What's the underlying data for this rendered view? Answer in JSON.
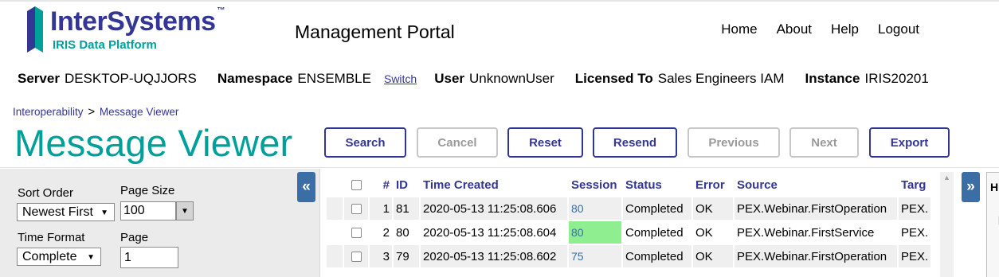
{
  "brand": {
    "name": "InterSystems",
    "trademark": "™",
    "subtitle": "IRIS Data Platform",
    "primary_color": "#333695",
    "accent_color": "#00a09a"
  },
  "header": {
    "portal_title": "Management Portal",
    "nav": [
      "Home",
      "About",
      "Help",
      "Logout"
    ]
  },
  "info": {
    "server_label": "Server",
    "server_value": "DESKTOP-UQJJORS",
    "namespace_label": "Namespace",
    "namespace_value": "ENSEMBLE",
    "switch_label": "Switch",
    "user_label": "User",
    "user_value": "UnknownUser",
    "licensed_label": "Licensed To",
    "licensed_value": "Sales Engineers IAM",
    "instance_label": "Instance",
    "instance_value": "IRIS20201"
  },
  "breadcrumb": {
    "parent": "Interoperability",
    "separator": ">",
    "current": "Message Viewer"
  },
  "page_title": "Message Viewer",
  "toolbar": {
    "buttons": [
      {
        "label": "Search",
        "enabled": true
      },
      {
        "label": "Cancel",
        "enabled": false
      },
      {
        "label": "Reset",
        "enabled": true
      },
      {
        "label": "Resend",
        "enabled": true
      },
      {
        "label": "Previous",
        "enabled": false
      },
      {
        "label": "Next",
        "enabled": false
      },
      {
        "label": "Export",
        "enabled": true
      }
    ]
  },
  "left_panel": {
    "collapse_icon": "«",
    "sort_order_label": "Sort Order",
    "sort_order_value": "Newest First",
    "page_size_label": "Page Size",
    "page_size_value": "100",
    "time_format_label": "Time Format",
    "time_format_value": "Complete",
    "page_label": "Page",
    "page_value": "1"
  },
  "table": {
    "columns": [
      "#",
      "ID",
      "Time Created",
      "Session",
      "Status",
      "Error",
      "Source",
      "Targ"
    ],
    "rows": [
      {
        "num": "1",
        "id": "81",
        "time": "2020-05-13 11:25:08.606",
        "session": "80",
        "status": "Completed",
        "error": "OK",
        "source": "PEX.Webinar.FirstOperation",
        "target": "PEX."
      },
      {
        "num": "2",
        "id": "80",
        "time": "2020-05-13 11:25:08.604",
        "session": "80",
        "status": "Completed",
        "error": "OK",
        "source": "PEX.Webinar.FirstService",
        "target": "PEX."
      },
      {
        "num": "3",
        "id": "79",
        "time": "2020-05-13 11:25:08.602",
        "session": "75",
        "status": "Completed",
        "error": "OK",
        "source": "PEX.Webinar.FirstOperation",
        "target": "PEX."
      }
    ],
    "highlight_color": "#8fee8f"
  },
  "right_panel": {
    "expand_icon": "»",
    "heading": "H",
    "bracket": "["
  }
}
